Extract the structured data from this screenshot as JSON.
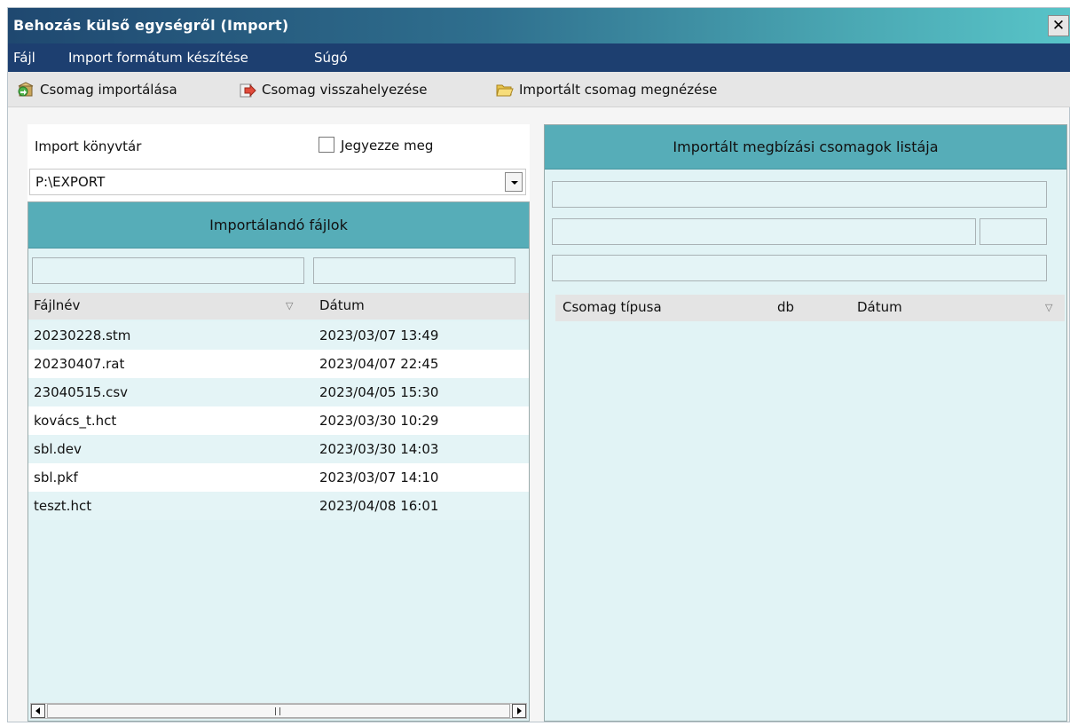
{
  "window": {
    "title": "Behozás külső egységről (Import)",
    "close_glyph": "✕"
  },
  "menu": {
    "items": [
      "Fájl",
      "Import formátum készítése",
      "Súgó"
    ]
  },
  "toolbar": {
    "import_label": "Csomag importálása",
    "import_icon": "package-import-icon",
    "restore_label": "Csomag visszahelyezése",
    "restore_icon": "package-restore-icon",
    "view_label": "Importált csomag megnézése",
    "view_icon": "folder-open-icon"
  },
  "import_dir": {
    "label": "Import könyvtár",
    "remember_label": "Jegyezze meg",
    "remember_checked": false,
    "value": "P:\\EXPORT"
  },
  "files_panel": {
    "title": "Importálandó fájlok",
    "columns": [
      "Fájlnév",
      "Dátum"
    ],
    "rows": [
      {
        "name": "20230228.stm",
        "date": "2023/03/07 13:49"
      },
      {
        "name": "20230407.rat",
        "date": "2023/04/07 22:45"
      },
      {
        "name": "23040515.csv",
        "date": "2023/04/05 15:30"
      },
      {
        "name": "kovács_t.hct",
        "date": "2023/03/30 10:29"
      },
      {
        "name": "sbl.dev",
        "date": "2023/03/30 14:03"
      },
      {
        "name": "sbl.pkf",
        "date": "2023/03/07 14:10"
      },
      {
        "name": "teszt.hct",
        "date": "2023/04/08 16:01"
      }
    ]
  },
  "packages_panel": {
    "title": "Importált megbízási csomagok listája",
    "columns": [
      "Csomag típusa",
      "db",
      "Dátum"
    ]
  },
  "colors": {
    "panel_header": "#56adb8",
    "panel_body": "#e1f3f5",
    "menubar": "#1d3f70"
  }
}
